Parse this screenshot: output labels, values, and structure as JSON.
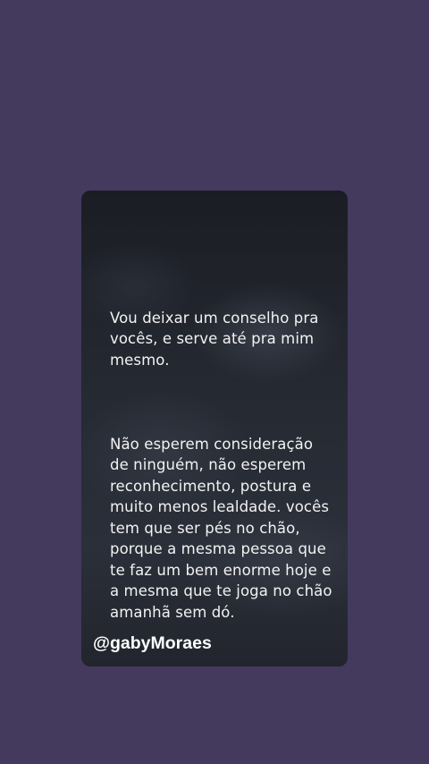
{
  "post": {
    "paragraph_1": "Vou deixar um conselho pra\nvocês, e serve até pra mim\nmesmo.",
    "paragraph_2": "Não esperem consideração\nde ninguém, não esperem\nreconhecimento, postura e\nmuito menos lealdade. vocês\ntem que ser pés no chão,\nporque a mesma pessoa que\nte faz um bem enorme hoje e\na mesma que te joga no chão\namanhã sem dó.",
    "author": "@gabyMoraes"
  },
  "colors": {
    "background": "#433a5e",
    "card": "#24272f",
    "text": "#f2f2f2"
  }
}
